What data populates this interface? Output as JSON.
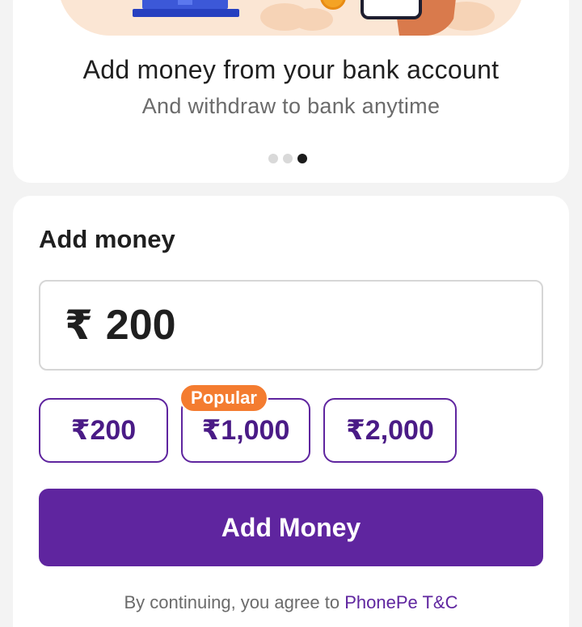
{
  "promo": {
    "title": "Add money from your bank account",
    "subtitle": "And withdraw to bank anytime",
    "pagination": {
      "total": 3,
      "active_index": 2
    }
  },
  "add_money": {
    "section_title": "Add money",
    "amount": {
      "currency_symbol": "₹",
      "value": "200"
    },
    "quick_amounts": [
      {
        "symbol": "₹",
        "amount": "200"
      },
      {
        "symbol": "₹",
        "amount": "1,000",
        "badge": "Popular"
      },
      {
        "symbol": "₹",
        "amount": "2,000"
      }
    ],
    "button_label": "Add Money",
    "terms_prefix": "By continuing, you agree to ",
    "terms_link": "PhonePe T&C"
  },
  "colors": {
    "brand_purple": "#5f259f",
    "badge_orange": "#f47c30",
    "page_bg": "#f3f3f3"
  }
}
